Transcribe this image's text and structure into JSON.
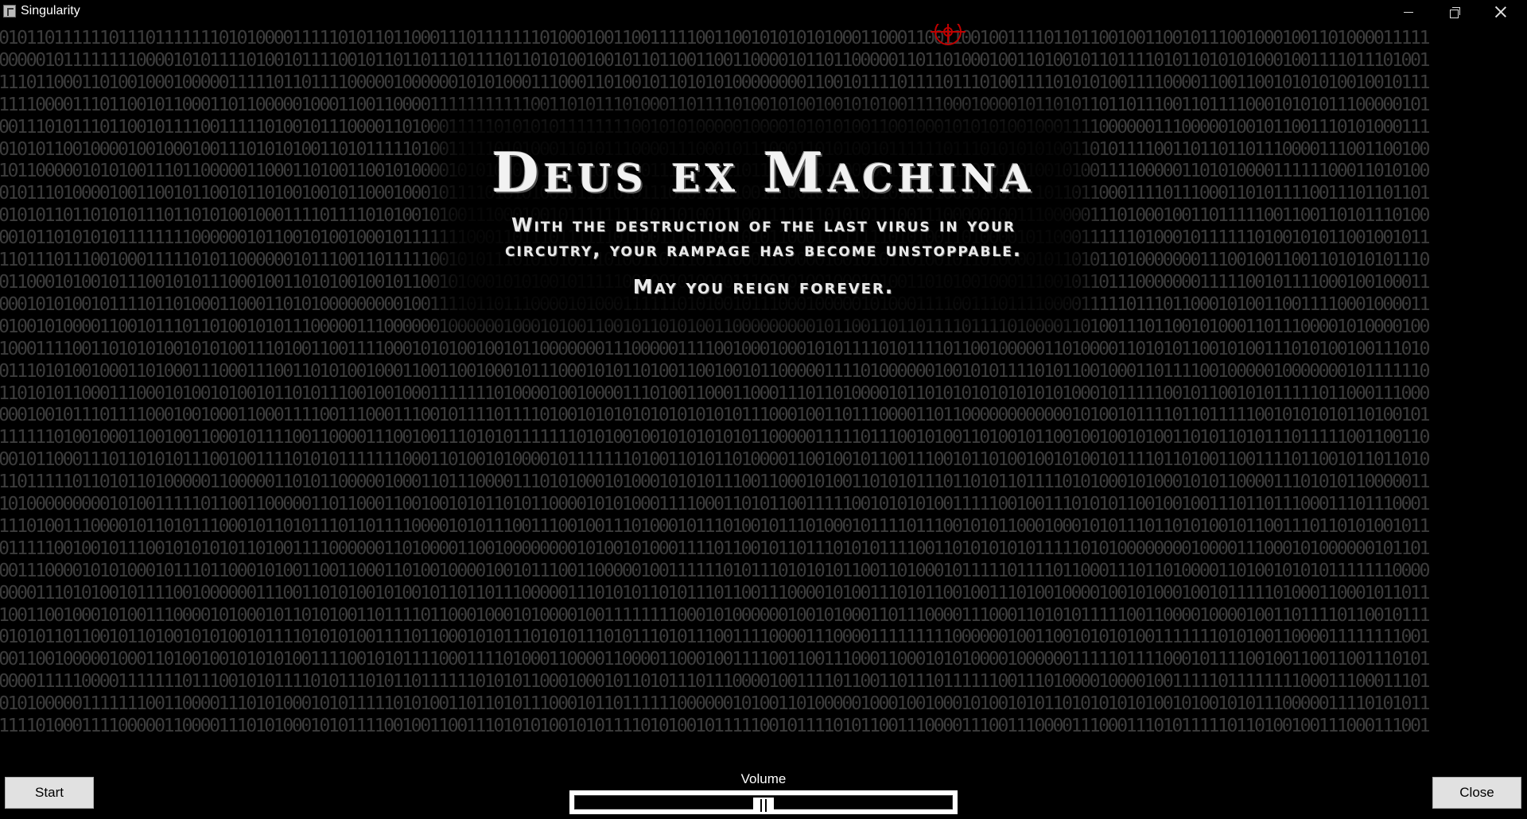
{
  "window": {
    "title": "Singularity",
    "icon": "app-icon",
    "controls": [
      "minimize-icon",
      "maximize-icon",
      "close-icon"
    ]
  },
  "background": {
    "binary_rows": [
      "010110111111011101111111010100001111101011011000111011111110100010011001111100110010101010100011000110011001001111011011001001100101110010001001101000011111",
      "000001011111111000010101111010010111100101101101110111101101010010010110110011001100001011011000001101101000100110100101101111010110101010001001111011101001",
      "111011000110100100010000011111011011110000010000001010100011100011010010110101010000000011001011110111101110100111101010100111100001100110010101010010010111",
      "111100001110110010110001101100000100011001100001111111111100110101110100011011110100101001001010100111100010000101101011011011100110111100010101011100000101",
      "001110101110110010111100111110100101110000110100011111010101011111111001010100000100001010101001100100010101010010001111000000111000001001011001110101000111",
      "010101100100001001000100111010101001101011111010011111010100011010111000011100010111000110101001011111101110101010100110101111001101101101110000111001100100",
      "101100000101010011101100000110001101001100101000010101000101111010001101110101011011001100110010011110001101010010010100111100000110101000011111100011010100",
      "010111010000100110010110010110100100101100010001011110101010010111101011101011101001110010111001101000100101001011011011000111101110001101011110011101101101",
      "010101101101010111011010100100011110111101010010100111000100101111111110110100111001111111010101110011100000100111000001110100010011011111001100110101110100",
      "001011010101011111111000000101100101001000101111111000110111011111101100111011011010110001111111101010011010000101100011111101000101111110100101011001001011",
      "110111011100100011111010110000001011100110111110010101110101010111010011011101110001100000100101011010010110100001011010110100000001110010011001101010101110",
      "011000101001011100101011100010011010100100101100101000101010010111110010010100001110010100100010100110101001000111001011011100000001111100101111000100100011",
      "000101010010111101101000110001101010000000001001111011011100001010001111110101001011100010000010100011110011101111000011111011101100010100110011110001000011",
      "010010100001100101110110100101011100000111000000100000010001010011001011010100110000000001011001101101111011110100001101001110110010100011011100001010000100",
      "100011110011010101001010100111010011001111000101010010010110000000111000001111001000100010101111010111101100100000110100001101010110010100111010100100111010",
      "011101010010001101000111000111001101010010001100110010001011100010101101001100100101100000111101000000100101011110101100100011011110010000010000000101111110",
      "110101011000111000101001010010110101110010010001111111010000100100001110100110001100011101101000010110101010101010101000101111100101100101011111011000111000",
      "000100101110111100010010001100011110011100011100101111011110100101010101010101010111000100110111000011011000000000000101001011110110111110010101010110100101",
      "111111010010001100100110001011110011000011100100111010101111111010100100101010101011000001111101110010100110100101100100100101001101011010111011111001100110",
      "001011000111011010101110010011110101011111110001101001010000101111111010011010110100001100100101100111001011010010010100101111011010011001111011001011011010",
      "110111110110101101000001100000110101100000100011011100001110101000101000101010111001100010100110101011101101011011110101000101000101011000011101010110000011",
      "101000000000101001111101100110000011011000110010010101101011000010101000111100011010110011111001010101001111100100111010101100100100111011011100011101110001",
      "111010011100001011010111000101101011101101111000010101110011100100111010001011101001011101000101111011100101011000100010101110110101001011001110110101001011",
      "011111001001011100101010101101001111000000110100001100100000000101001010001111011001011011101010111100110101010101111101010000000010000111000101000000101101",
      "001110000101010001011101100010100110011000110100100001001011100110000010011111101011101010101100110100010111110111101100011101101000011010010101011111110000",
      "000011101010010111100100000011100110101001010010110110111000001110101011010111011001110000101001110101100100111010010000100101000100101111101000110001011011",
      "100110010001010011100001010001011010100110111101100010001010000100111111110001010000001001010001101110000111000110101011111001100001000010011011110110010111",
      "010101101100101101001010100101111010101001111011000101011101010111010111010111001111000011100001111111110000001001100101010100111111101010011000011111111001",
      "001100100000100011010010010101010011110010101111000111101000110000110000110001001111001100111000110001010100001000000111110111100010111100100110011001110101",
      "000011111000011111110111001010111101011101011011111101010110001000101101011101110000100111101100110111011111100111010000100001001111101111111100011100011101",
      "010100000111111100110000111010100010101111101010011011010111000101101111110000001010011010000010001001000101001010110101010101001010010101110000011110101011",
      "111101000111100000110000111010100010101111001001100111010101001010111101010010111110010111101011001110000111001110000111000111010111110110100100111000111001"
    ]
  },
  "message": {
    "headline": "Deus ex Machina",
    "line1": "With the destruction of the last virus in your",
    "line2": "circutry, your rampage has become unstoppable.",
    "farewell": "May you reign forever."
  },
  "controls": {
    "start_label": "Start",
    "close_label": "Close",
    "volume_label": "Volume",
    "volume_level": 0.5
  },
  "colors": {
    "background": "#000000",
    "binary_text": "#3c3c3c",
    "crosshair": "#c00000",
    "button_face": "#e1e1e1"
  }
}
